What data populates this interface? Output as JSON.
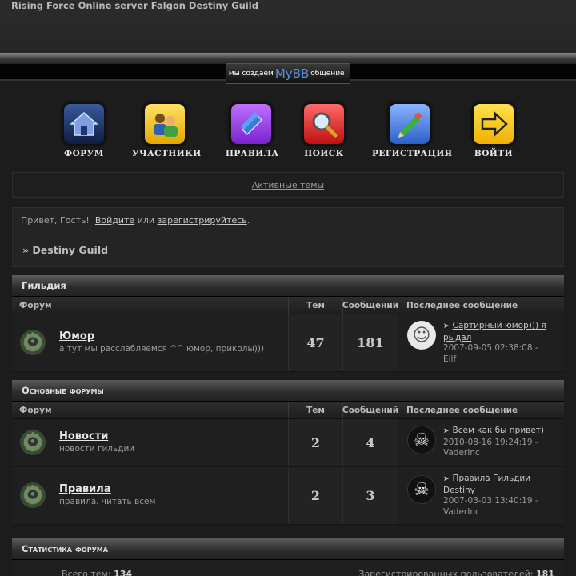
{
  "header": {
    "site_title": "Rising Force Online server Falgon Destiny Guild",
    "mybb_pre": "мы создаем",
    "mybb_logo": "MyBB",
    "mybb_post": "общение!"
  },
  "nav": [
    {
      "label": "ФОРУМ",
      "icon": "home-icon"
    },
    {
      "label": "УЧАСТНИКИ",
      "icon": "users-icon"
    },
    {
      "label": "ПРАВИЛА",
      "icon": "book-icon"
    },
    {
      "label": "ПОИСК",
      "icon": "magnifier-icon"
    },
    {
      "label": "РЕГИСТРАЦИЯ",
      "icon": "pencil-icon"
    },
    {
      "label": "ВОЙТИ",
      "icon": "arrow-right-icon"
    }
  ],
  "active_topics_link": "Активные темы",
  "welcome": {
    "greeting": "Привет, Гость!",
    "login_link": "Войдите",
    "or_text": "или",
    "register_link": "зарегистрируйтесь",
    "period": ".",
    "breadcrumb": "» Destiny Guild"
  },
  "columns": {
    "forum": "Форум",
    "topics": "Тем",
    "posts": "Сообщений",
    "last_post": "Последнее сообщение"
  },
  "categories": [
    {
      "title": "Гильдия",
      "forums": [
        {
          "name": "Юмор",
          "desc": "а тут мы расслабляемся ^^ юмор, приколы)))",
          "topics": "47",
          "posts": "181",
          "last_title": "Сартирный юмор))) я рыдал",
          "last_date": "2007-09-05 02:38:08 -",
          "last_author": "Eilf"
        }
      ]
    },
    {
      "title": "Основные форумы",
      "forums": [
        {
          "name": "Новости",
          "desc": "новости гильдии",
          "topics": "2",
          "posts": "4",
          "last_title": "Всем как бы привет)",
          "last_date": "2010-08-16 19:24:19 -",
          "last_author": "VaderInc"
        },
        {
          "name": "Правила",
          "desc": "правила. читать всем",
          "topics": "2",
          "posts": "3",
          "last_title": "Правила Гильдии Destiny",
          "last_date": "2007-03-03 13:40:19 -",
          "last_author": "VaderInc"
        }
      ]
    }
  ],
  "stats": {
    "title": "Статистика форума",
    "total_topics_label": "Всего тем:",
    "total_topics": "134",
    "registered_label": "Зарегистрированных пользователей:",
    "registered": "181"
  }
}
